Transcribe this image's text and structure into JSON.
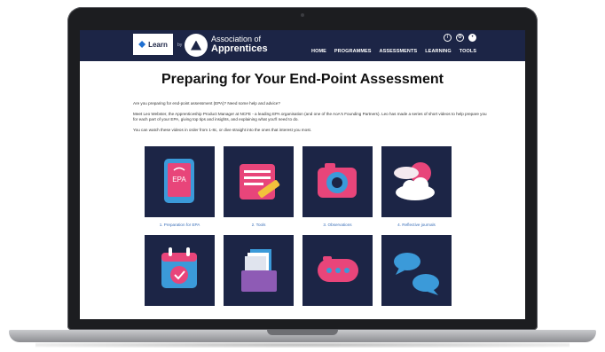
{
  "header": {
    "learn_logo": "Learn",
    "by": "by",
    "org_line1": "Association of",
    "org_line2": "Apprentices",
    "icons": [
      "info-icon",
      "settings-icon",
      "account-icon"
    ],
    "nav": [
      "HOME",
      "PROGRAMMES",
      "ASSESSMENTS",
      "LEARNING",
      "TOOLS"
    ]
  },
  "main": {
    "title": "Preparing for Your End-Point Assessment",
    "intro": "Are you preparing for end-point assessment (EPA)? Need some help and advice?",
    "about": "Meet Leo Webster, the Apprenticeship Product Manager at NCFE - a leading EPA organisation (and one of the AoA's Founding Partners). Leo has made a series of short videos to help prepare you for each part of your EPA, giving top tips and insights, and explaining what you'll need to do.",
    "instructions": "You can watch these videos in order from 1-8c, or dive straight into the ones that interest you most.",
    "tiles": [
      {
        "caption": "1.   Preparation for EPA",
        "icon": "epa-tablet-icon",
        "badge": "EPA"
      },
      {
        "caption": "2.   Tools",
        "icon": "notebook-pencil-icon"
      },
      {
        "caption": "3.   Observations",
        "icon": "camera-icon"
      },
      {
        "caption": "4.   Reflective journals",
        "icon": "cloud-sun-icon"
      },
      {
        "caption": "",
        "icon": "calendar-check-icon"
      },
      {
        "caption": "",
        "icon": "folder-documents-icon"
      },
      {
        "caption": "",
        "icon": "chat-bubble-icon"
      },
      {
        "caption": "",
        "icon": "conversation-icon"
      }
    ]
  },
  "colors": {
    "navy": "#1c2546",
    "pink": "#e8457a",
    "blue": "#3b9ad9",
    "link": "#3a6fb8"
  }
}
